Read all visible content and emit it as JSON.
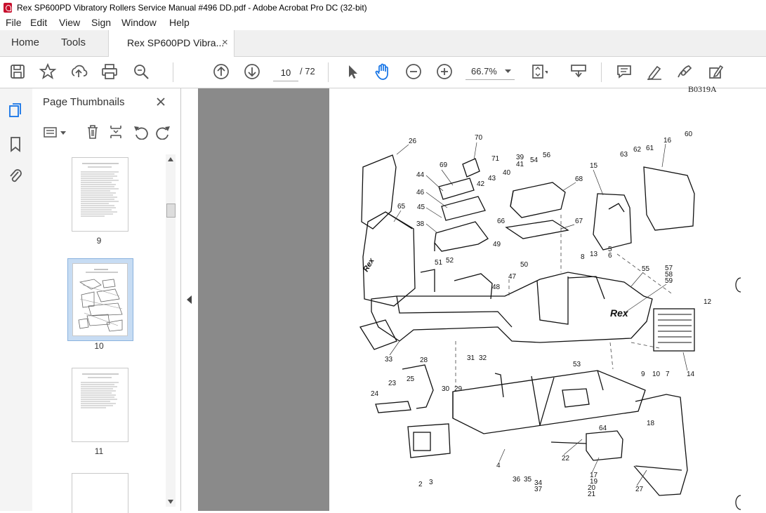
{
  "window": {
    "title": "Rex SP600PD Vibratory Rollers Service Manual #496 DD.pdf - Adobe Acrobat Pro DC (32-bit)"
  },
  "menu": {
    "items": [
      "File",
      "Edit",
      "View",
      "Sign",
      "Window",
      "Help"
    ]
  },
  "tabs": {
    "home": "Home",
    "tools": "Tools",
    "document": "Rex SP600PD Vibra...",
    "close": "×"
  },
  "toolbar": {
    "current_page": "10",
    "total_pages": "/ 72",
    "zoom": "66.7%",
    "icons": [
      "save-icon",
      "bookmark-star-icon",
      "upload-icon",
      "print-icon",
      "zoom-search-icon",
      "prev-page-icon",
      "next-page-icon",
      "select-arrow-icon",
      "hand-icon",
      "zoom-out-icon",
      "zoom-in-icon",
      "fit-page-icon",
      "scroll-mode-icon",
      "comment-icon",
      "highlight-pen-icon",
      "sign-icon",
      "fill-sign-icon"
    ]
  },
  "panel": {
    "title": "Page Thumbnails",
    "thumbnails": [
      {
        "label": "9",
        "selected": false
      },
      {
        "label": "10",
        "selected": true
      },
      {
        "label": "11",
        "selected": false
      },
      {
        "label": "",
        "selected": false
      }
    ]
  },
  "document": {
    "page_code": "B0319A",
    "brand_text": "Rex",
    "part_numbers": [
      "26",
      "70",
      "71",
      "39",
      "41",
      "54",
      "56",
      "68",
      "44",
      "69",
      "43",
      "42",
      "40",
      "46",
      "45",
      "66",
      "38",
      "67",
      "15",
      "16",
      "60",
      "63",
      "62",
      "61",
      "65",
      "49",
      "51",
      "52",
      "50",
      "47",
      "48",
      "8",
      "13",
      "5",
      "6",
      "55",
      "57",
      "58",
      "59",
      "12",
      "33",
      "53",
      "28",
      "31",
      "32",
      "30",
      "29",
      "23",
      "25",
      "24",
      "9",
      "10",
      "7",
      "14",
      "64",
      "18",
      "22",
      "4",
      "2",
      "3",
      "36",
      "35",
      "34",
      "37",
      "17",
      "19",
      "20",
      "21",
      "27"
    ]
  },
  "colors": {
    "accent": "#1473e6",
    "doc_bg": "#8a8a8a",
    "tab_bg": "#f0f0f0"
  }
}
